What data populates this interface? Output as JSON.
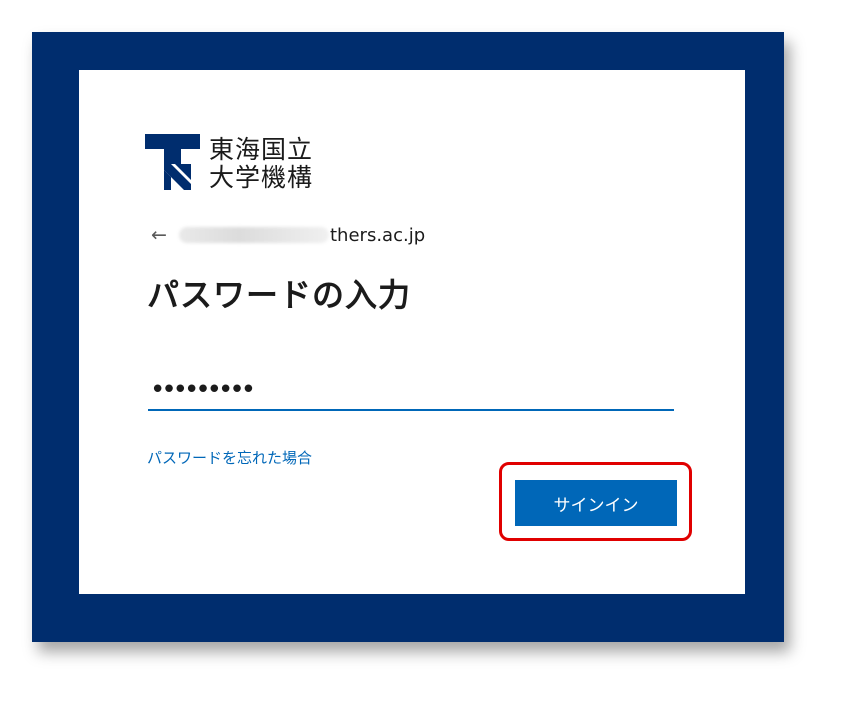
{
  "logo": {
    "line1": "東海国立",
    "line2": "大学機構",
    "mark_color": "#002d6e"
  },
  "identity": {
    "back_icon": "left-arrow-icon",
    "domain_suffix": "thers.ac.jp"
  },
  "page": {
    "title": "パスワードの入力"
  },
  "password_field": {
    "value": "•••••••••"
  },
  "links": {
    "forgot_password": "パスワードを忘れた場合"
  },
  "actions": {
    "sign_in_label": "サインイン"
  },
  "colors": {
    "frame": "#002d6e",
    "accent": "#0067b8",
    "highlight": "#e00000"
  }
}
